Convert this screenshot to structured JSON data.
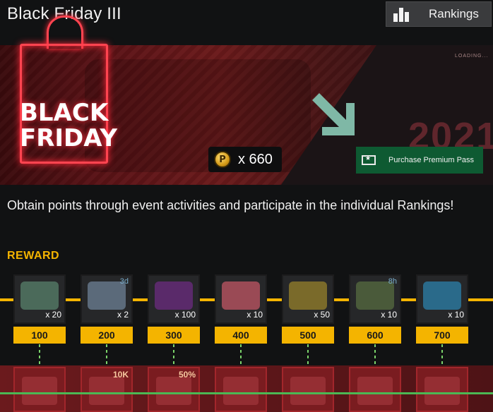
{
  "header": {
    "title": "Black Friday III",
    "rankings_label": "Rankings"
  },
  "banner": {
    "bag_text": "BLACK FRIDAY",
    "loading_text": "LOADING...",
    "year_text": "2021",
    "points_value": "x 660",
    "coin_letter": "P",
    "premium_label": "Purchase Premium Pass"
  },
  "description": "Obtain points through event activities and participate in the individual Rankings!",
  "reward": {
    "heading": "REWARD",
    "items": [
      {
        "qty": "x 20",
        "score": "100",
        "tag": "",
        "color": "#4b6a5a"
      },
      {
        "qty": "x 2",
        "score": "200",
        "tag": "3d",
        "color": "#5b6a7a"
      },
      {
        "qty": "x 100",
        "score": "300",
        "tag": "",
        "color": "#5a2a6a"
      },
      {
        "qty": "x 10",
        "score": "400",
        "tag": "",
        "color": "#9a4a55"
      },
      {
        "qty": "x 50",
        "score": "500",
        "tag": "",
        "color": "#7a6a2a"
      },
      {
        "qty": "x 10",
        "score": "600",
        "tag": "8h",
        "color": "#4a5a3a"
      },
      {
        "qty": "x 10",
        "score": "700",
        "tag": "",
        "color": "#2a6a8a"
      }
    ],
    "premium_tags": [
      "",
      "10K",
      "50%",
      "",
      "",
      "",
      ""
    ]
  },
  "colors": {
    "accent": "#f4b400",
    "premium_green": "#0e5a32",
    "banner_red": "#6b1a1b"
  }
}
